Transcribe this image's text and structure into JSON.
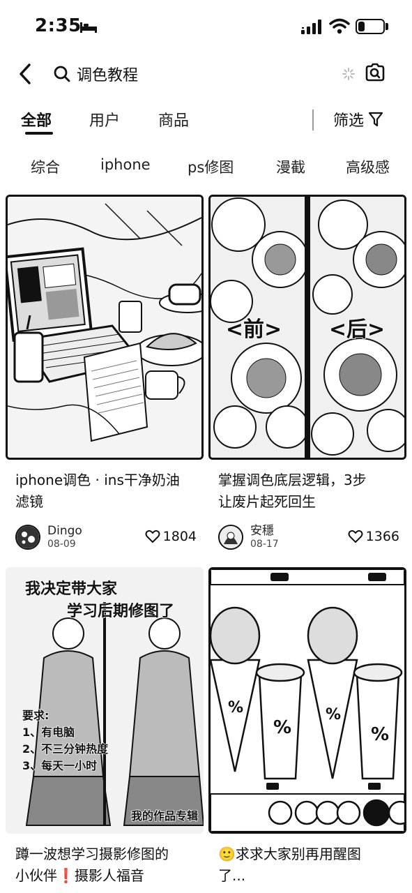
{
  "status_bar": {
    "time": "2:35",
    "battery": "24",
    "battery_level": 0.24,
    "icons": [
      "bed-icon",
      "signal-icon",
      "wifi-icon",
      "battery-icon"
    ]
  },
  "search": {
    "back_icon": "chevron-left-icon",
    "search_icon": "search-icon",
    "query": "调色教程",
    "camera_icon": "camera-search-icon"
  },
  "tabs": {
    "items": [
      {
        "label": "全部",
        "active": true
      },
      {
        "label": "用户",
        "active": false
      },
      {
        "label": "商品",
        "active": false
      }
    ],
    "filter_label": "筛选",
    "filter_icon": "funnel-icon"
  },
  "chips": [
    "综合",
    "iphone",
    "ps修图",
    "漫截",
    "高级感"
  ],
  "feed": [
    {
      "title": "iphone调色 · ins干净奶油滤镜",
      "title_line1": "iphone调色 · ins干净奶油",
      "title_line2": "滤镜",
      "author": "Dingo",
      "date": "08-09",
      "likes": "1804"
    },
    {
      "title": "掌握调色底层逻辑，3步让废片起死回生",
      "title_line1": "掌握调色底层逻辑，3步",
      "title_line2": "让废片起死回生",
      "author": "安穩",
      "date": "08-17",
      "likes": "1366",
      "image_labels": [
        "<前>",
        "<后>"
      ]
    },
    {
      "title": "蹲一波想学习摄影修图的小伙伴❗摄影人福音",
      "title_line1": "蹲一波想学习摄影修图的",
      "title_line2": "小伙伴❗摄影人福音",
      "image_text": {
        "headline1": "我决定带大家",
        "headline2": "学习后期修图了",
        "req_title": "要求:",
        "req1": "1、有电脑",
        "req2": "2、不三分钟热度",
        "req3": "3、每天一小时",
        "footer": "我的作品专辑"
      }
    },
    {
      "title": "🙂求求大家别再用醒图了...",
      "title_line1": "🙂求求大家别再用醒图",
      "title_line2": "了..."
    }
  ]
}
